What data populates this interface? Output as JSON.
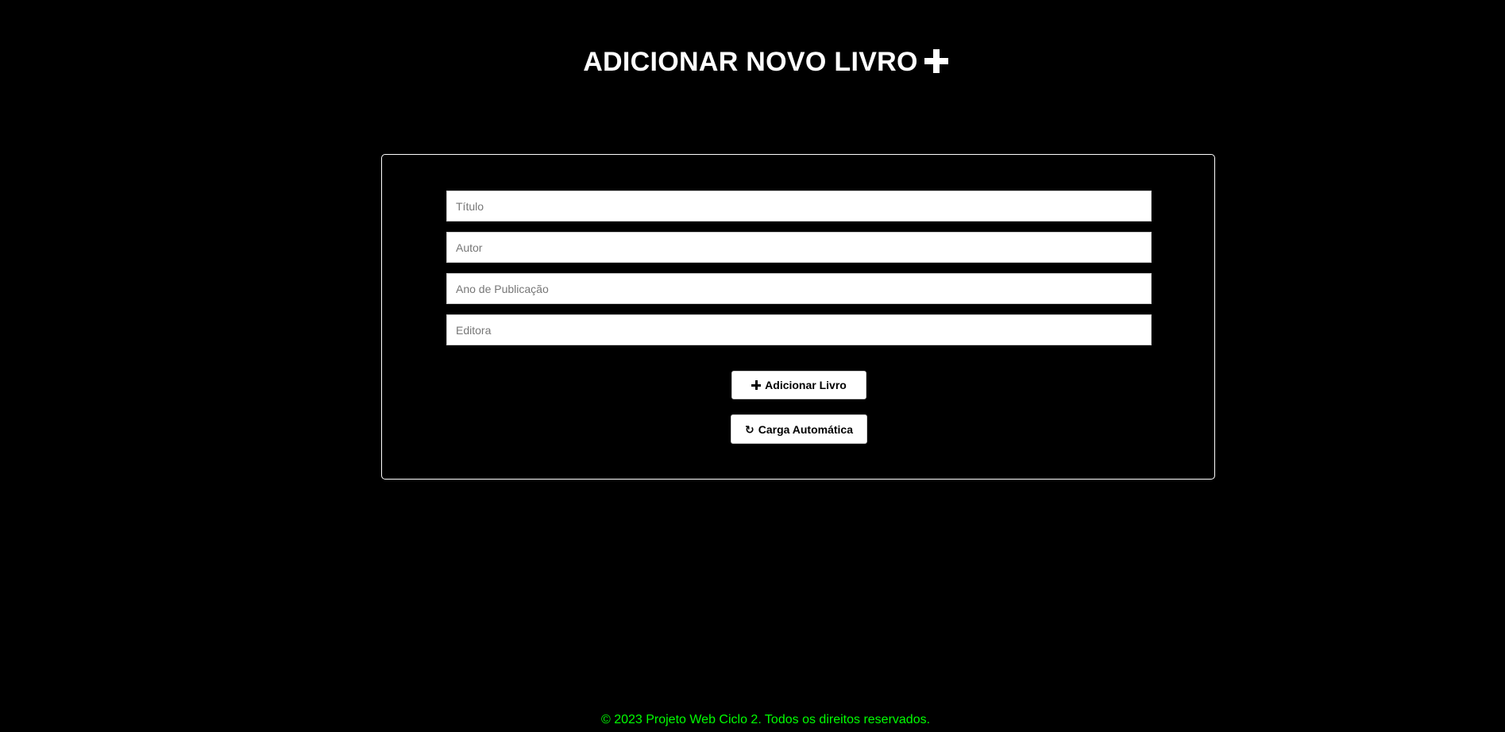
{
  "header": {
    "title": "ADICIONAR NOVO LIVRO",
    "title_icon": "plus-icon"
  },
  "form": {
    "fields": [
      {
        "name": "titulo",
        "placeholder": "Título",
        "value": ""
      },
      {
        "name": "autor",
        "placeholder": "Autor",
        "value": ""
      },
      {
        "name": "ano",
        "placeholder": "Ano de Publicação",
        "value": ""
      },
      {
        "name": "editora",
        "placeholder": "Editora",
        "value": ""
      }
    ],
    "add_button": {
      "label": "Adicionar Livro",
      "icon": "plus-icon"
    },
    "load_button": {
      "label": "Carga Automática",
      "icon": "refresh-icon"
    }
  },
  "footer": {
    "text": "© 2023 Projeto Web Ciclo 2. Todos os direitos reservados.",
    "color": "#00ff00"
  },
  "theme": {
    "background": "#000000",
    "text": "#ffffff",
    "accent": "#00ff00"
  }
}
